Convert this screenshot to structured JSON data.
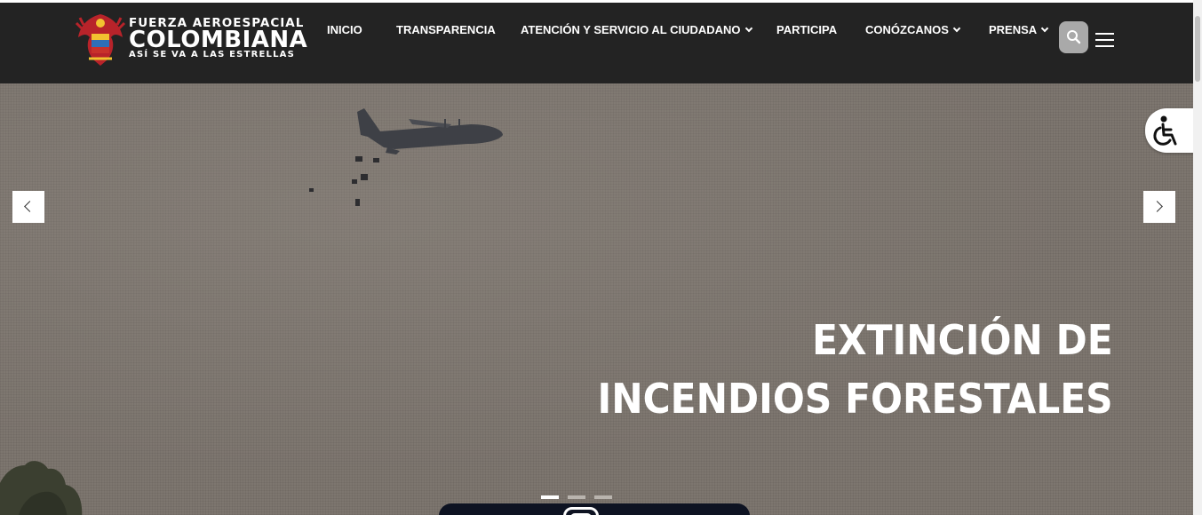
{
  "header": {
    "logo": {
      "line1": "FUERZA AEROESPACIAL",
      "line2": "COLOMBIANA",
      "line3": "ASÍ SE VA A LAS ESTRELLAS"
    },
    "nav": [
      {
        "label": "INICIO",
        "has_dropdown": false
      },
      {
        "label": "TRANSPARENCIA",
        "has_dropdown": false
      },
      {
        "label": "ATENCIÓN Y SERVICIO AL CIUDADANO",
        "has_dropdown": true
      },
      {
        "label": "PARTICIPA",
        "has_dropdown": false
      },
      {
        "label": "CONÓZCANOS",
        "has_dropdown": true
      },
      {
        "label": "PRENSA",
        "has_dropdown": true
      }
    ],
    "search_icon": "search-icon",
    "menu_icon": "hamburger-menu-icon"
  },
  "hero": {
    "title_line1": "EXTINCIÓN DE",
    "title_line2": "INCENDIOS FORESTALES",
    "slide_count": 3,
    "active_slide": 1,
    "prev_icon": "chevron-left-icon",
    "next_icon": "chevron-right-icon"
  },
  "accessibility": {
    "icon": "wheelchair-accessibility-icon"
  },
  "colors": {
    "header_bg": "#232323",
    "hero_bg": "#7d766f",
    "search_bg": "#a9a9a9",
    "pill_bg": "#0e1322"
  }
}
